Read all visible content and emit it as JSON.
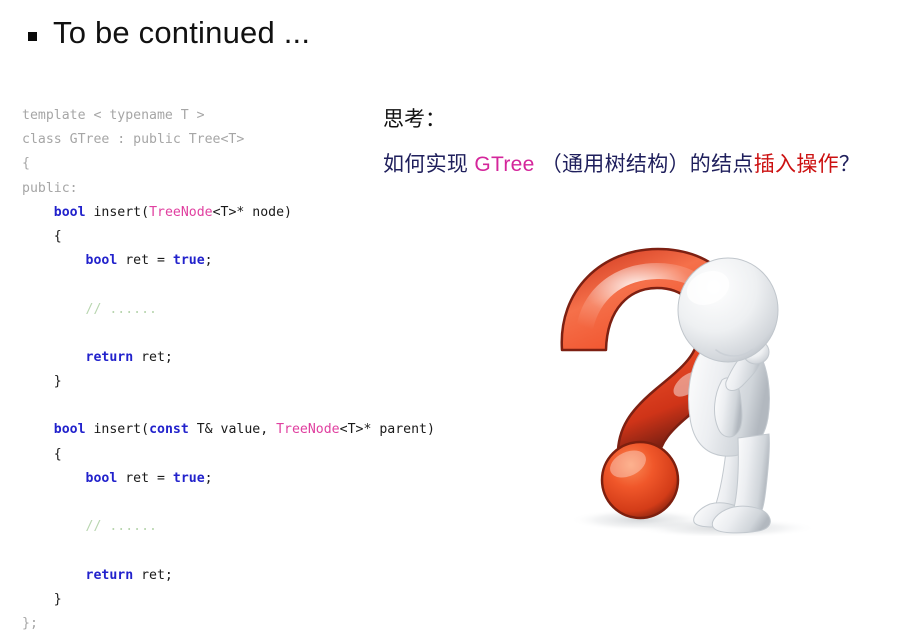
{
  "slide": {
    "title": "To be continued ...",
    "bullet_glyph": "square"
  },
  "code": {
    "language": "cpp",
    "lines": [
      [
        {
          "t": "template < typename T >",
          "c": "gray"
        }
      ],
      [
        {
          "t": "class GTree : public Tree<T>",
          "c": "gray"
        }
      ],
      [
        {
          "t": "{",
          "c": "gray"
        }
      ],
      [
        {
          "t": "public:",
          "c": "gray"
        }
      ],
      [
        {
          "t": "    ",
          "c": "plain"
        },
        {
          "t": "bool",
          "c": "kw"
        },
        {
          "t": " insert(",
          "c": "plain"
        },
        {
          "t": "TreeNode",
          "c": "type"
        },
        {
          "t": "<T>* node)",
          "c": "plain"
        }
      ],
      [
        {
          "t": "    {",
          "c": "plain"
        }
      ],
      [
        {
          "t": "        ",
          "c": "plain"
        },
        {
          "t": "bool",
          "c": "kw"
        },
        {
          "t": " ret = ",
          "c": "plain"
        },
        {
          "t": "true",
          "c": "kw"
        },
        {
          "t": ";",
          "c": "plain"
        }
      ],
      [
        {
          "t": "",
          "c": "plain"
        }
      ],
      [
        {
          "t": "        ",
          "c": "plain"
        },
        {
          "t": "// ......",
          "c": "comment"
        }
      ],
      [
        {
          "t": "",
          "c": "plain"
        }
      ],
      [
        {
          "t": "        ",
          "c": "plain"
        },
        {
          "t": "return",
          "c": "kw"
        },
        {
          "t": " ret;",
          "c": "plain"
        }
      ],
      [
        {
          "t": "    }",
          "c": "plain"
        }
      ],
      [
        {
          "t": "",
          "c": "plain"
        }
      ],
      [
        {
          "t": "    ",
          "c": "plain"
        },
        {
          "t": "bool",
          "c": "kw"
        },
        {
          "t": " insert(",
          "c": "plain"
        },
        {
          "t": "const",
          "c": "kw"
        },
        {
          "t": " T& value, ",
          "c": "plain"
        },
        {
          "t": "TreeNode",
          "c": "type"
        },
        {
          "t": "<T>* parent)",
          "c": "plain"
        }
      ],
      [
        {
          "t": "    {",
          "c": "plain"
        }
      ],
      [
        {
          "t": "        ",
          "c": "plain"
        },
        {
          "t": "bool",
          "c": "kw"
        },
        {
          "t": " ret = ",
          "c": "plain"
        },
        {
          "t": "true",
          "c": "kw"
        },
        {
          "t": ";",
          "c": "plain"
        }
      ],
      [
        {
          "t": "",
          "c": "plain"
        }
      ],
      [
        {
          "t": "        ",
          "c": "plain"
        },
        {
          "t": "// ......",
          "c": "comment"
        }
      ],
      [
        {
          "t": "",
          "c": "plain"
        }
      ],
      [
        {
          "t": "        ",
          "c": "plain"
        },
        {
          "t": "return",
          "c": "kw"
        },
        {
          "t": " ret;",
          "c": "plain"
        }
      ],
      [
        {
          "t": "    }",
          "c": "plain"
        }
      ],
      [
        {
          "t": "};",
          "c": "gray"
        }
      ]
    ]
  },
  "prompt": {
    "label": "思考：",
    "question_segments": [
      {
        "text": "如何实现 ",
        "color_role": "navy"
      },
      {
        "text": "GTree",
        "color_role": "magenta"
      },
      {
        "text": " （通用树结构）的结点",
        "color_role": "navy"
      },
      {
        "text": "插入操作",
        "color_role": "red"
      },
      {
        "text": "？",
        "color_role": "navy"
      }
    ]
  },
  "illustration": {
    "name": "thinking-figure-question-mark",
    "description": "3D glossy red question mark with white humanoid figure in thinking pose"
  },
  "colors": {
    "title": "#111111",
    "navy": "#1f1f5c",
    "magenta": "#d4269b",
    "red": "#cc1111",
    "code_gray": "#a6a6a6",
    "code_keyword": "#2222cc",
    "code_type": "#e040a0",
    "code_comment": "#b9d6b0",
    "qmark_bright": "#f5603c",
    "qmark_dark": "#8b2418",
    "figure_white": "#f2f3f5",
    "background": "#ffffff"
  }
}
